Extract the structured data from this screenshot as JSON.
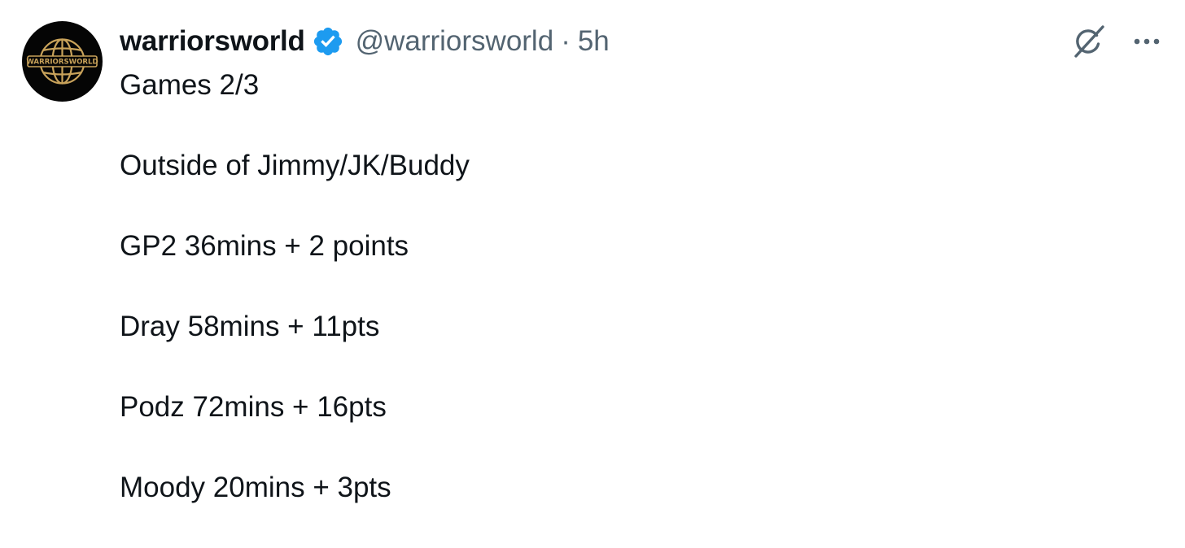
{
  "tweet": {
    "display_name": "warriorsworld",
    "handle": "@warriorsworld",
    "separator": "·",
    "time": "5h",
    "avatar_text": "WARRIORSWORLD",
    "lines": [
      "Games 2/3",
      "Outside of Jimmy/JK/Buddy",
      "GP2 36mins + 2 points",
      "Dray 58mins + 11pts",
      "Podz 72mins + 16pts",
      "Moody 20mins + 3pts"
    ]
  },
  "icons": {
    "verified": "verified-badge-icon",
    "grok": "grok-icon",
    "more": "more-options-icon"
  },
  "colors": {
    "text": "#0f1419",
    "secondary": "#536471",
    "verified_blue": "#1d9bf0",
    "avatar_bg": "#050505",
    "avatar_gold": "#c8a25a"
  }
}
